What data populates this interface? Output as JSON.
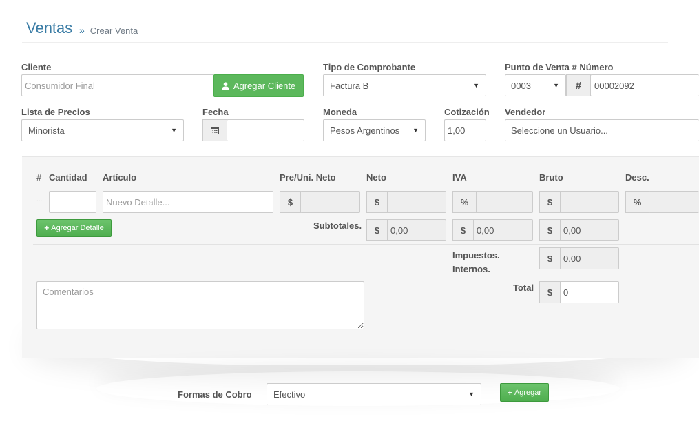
{
  "header": {
    "title": "Ventas",
    "separator": "»",
    "breadcrumb": "Crear Venta"
  },
  "form": {
    "cliente": {
      "label": "Cliente",
      "value": "Consumidor Final",
      "add_button": "Agregar Cliente",
      "add_icon": "user-icon"
    },
    "tipo_comprobante": {
      "label": "Tipo de Comprobante",
      "value": "Factura B"
    },
    "punto_venta": {
      "label": "Punto de Venta # Número",
      "punto": "0003",
      "hash": "#",
      "numero": "00002092"
    },
    "lista_precios": {
      "label": "Lista de Precios",
      "value": "Minorista"
    },
    "fecha": {
      "label": "Fecha",
      "value": "",
      "icon": "calendar-icon"
    },
    "moneda": {
      "label": "Moneda",
      "value": "Pesos Argentinos"
    },
    "cotizacion": {
      "label": "Cotización",
      "value": "1,00"
    },
    "vendedor": {
      "label": "Vendedor",
      "placeholder": "Seleccione un Usuario..."
    }
  },
  "detail": {
    "columns": {
      "num": "#",
      "cantidad": "Cantidad",
      "articulo": "Artículo",
      "pre_uni_neto": "Pre/Uni. Neto",
      "neto": "Neto",
      "iva": "IVA",
      "bruto": "Bruto",
      "desc": "Desc."
    },
    "row": {
      "dots": "...",
      "cantidad": "",
      "articulo_placeholder": "Nuevo Detalle...",
      "currency": "$",
      "percent": "%"
    },
    "add_detail_button": "Agregar Detalle",
    "subtotales": {
      "label": "Subtotales.",
      "neto": "0,00",
      "iva": "0,00",
      "bruto": "0,00"
    },
    "impuestos": {
      "label_line1": "Impuestos.",
      "label_line2": "Internos.",
      "value": "0.00"
    },
    "comentarios_placeholder": "Comentarios",
    "total": {
      "label": "Total",
      "value": "0"
    }
  },
  "cobro": {
    "label": "Formas de Cobro",
    "value": "Efectivo",
    "add_button": "Agregar"
  },
  "colors": {
    "title": "#3a7ca5",
    "green": "#5cb85c",
    "panel_bg": "#f5f5f5"
  }
}
